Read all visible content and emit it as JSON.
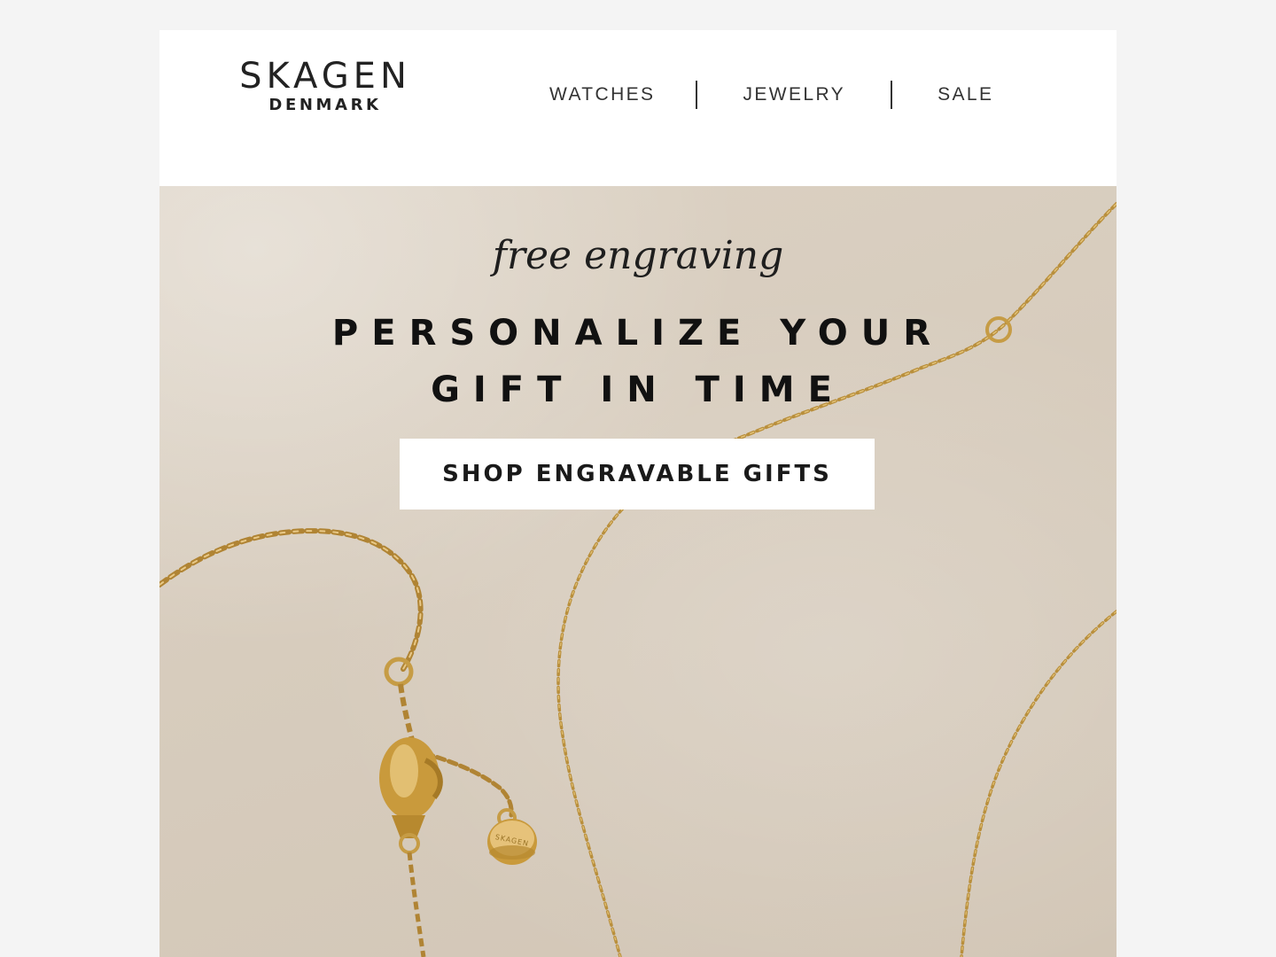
{
  "header": {
    "logo": {
      "main": "SKAGEN",
      "sub": "DENMARK"
    },
    "nav": [
      {
        "label": "WATCHES"
      },
      {
        "label": "JEWELRY"
      },
      {
        "label": "SALE"
      }
    ]
  },
  "hero": {
    "kicker": "free engraving",
    "headline_line1": "PERSONALIZE YOUR",
    "headline_line2": "GIFT IN TIME",
    "cta_label": "SHOP ENGRAVABLE GIFTS",
    "tag_engraving": "SKAGEN"
  },
  "colors": {
    "page_background": "#f4f4f4",
    "hero_background": "#d7ccbd",
    "gold": "#c9a24a",
    "text": "#111111"
  }
}
